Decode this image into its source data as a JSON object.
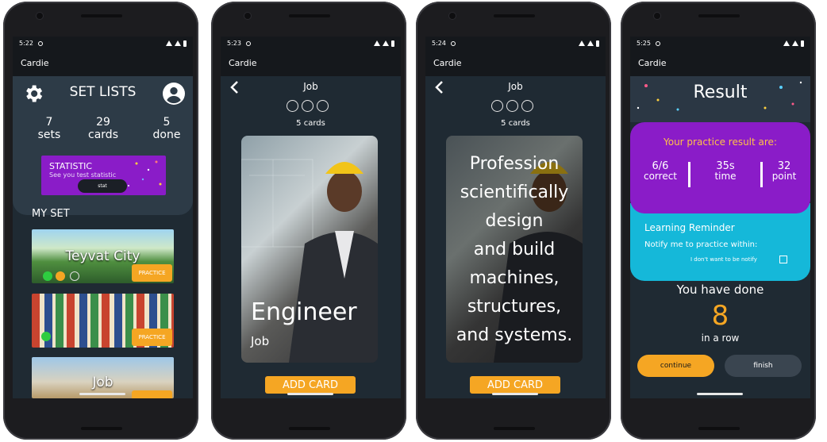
{
  "app_name": "Cardie",
  "screens": [
    {
      "time": "5:22",
      "title": "SET LISTS",
      "stats": [
        {
          "value": "7",
          "label": "sets"
        },
        {
          "value": "29",
          "label": "cards"
        },
        {
          "value": "5",
          "label": "done"
        }
      ],
      "banner": {
        "title": "STATISTIC",
        "subtitle": "See you test statistic",
        "button": "stat"
      },
      "section": "MY SET",
      "sets": [
        {
          "name": "Teyvat City",
          "action": "PRACTICE"
        },
        {
          "name": "",
          "action": "PRACTICE"
        },
        {
          "name": "Job",
          "action": ""
        }
      ]
    },
    {
      "time": "5:23",
      "set_title": "Job",
      "count": "5 cards",
      "card_word": "Engineer",
      "card_category": "Job",
      "button": "ADD CARD"
    },
    {
      "time": "5:24",
      "set_title": "Job",
      "count": "5 cards",
      "definition": [
        "Profession",
        "scientifically",
        "design",
        "and build",
        "machines,",
        "structures,",
        "and systems."
      ],
      "button": "ADD CARD"
    },
    {
      "time": "5:25",
      "title": "Result",
      "question": "Your practice result are:",
      "results": [
        {
          "value": "6/6",
          "label": "correct"
        },
        {
          "value": "35s",
          "label": "time"
        },
        {
          "value": "32",
          "label": "point"
        }
      ],
      "reminder_title": "Learning Reminder",
      "reminder_sub": "Notify me to practice within:",
      "reminder_opt": "I don't want to be notify",
      "done_text": "You have done",
      "done_count": "8",
      "done_suffix": "in a row",
      "btn_continue": "continue",
      "btn_finish": "finish"
    }
  ],
  "colors": {
    "accent": "#f5a623",
    "purple": "#8a1cc8",
    "cyan": "#15b8d9",
    "bg": "#1f2a33"
  }
}
